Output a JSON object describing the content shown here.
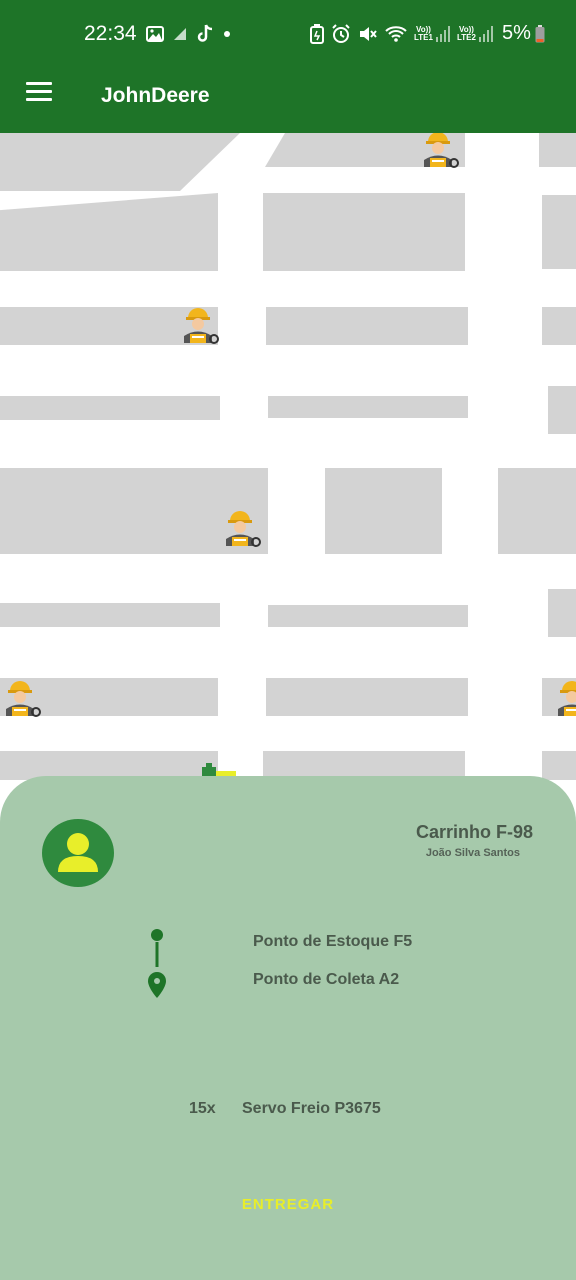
{
  "status_bar": {
    "time": "22:34",
    "lte1": "LTE1",
    "lte2": "LTE2",
    "volte": "Vo))",
    "battery": "5%"
  },
  "app_bar": {
    "title": "JohnDeere",
    "menu_icon": "hamburger-menu-icon"
  },
  "map": {
    "marker_icon": "mechanic-worker-icon",
    "block_color": "#d3d3d3"
  },
  "bottom_sheet": {
    "vehicle": "Carrinho F-98",
    "driver": "João Silva Santos",
    "origin": "Ponto de Estoque F5",
    "destination": "Ponto de Coleta A2",
    "item_quantity": "15x",
    "item_name": "Servo Freio P3675",
    "action_label": "ENTREGAR"
  },
  "colors": {
    "primary": "#1e7428",
    "sheet_bg": "#a6c9ab",
    "avatar_bg": "#2f8a3e",
    "avatar_fg": "#e8ee2a",
    "action": "#e8ee2a"
  }
}
